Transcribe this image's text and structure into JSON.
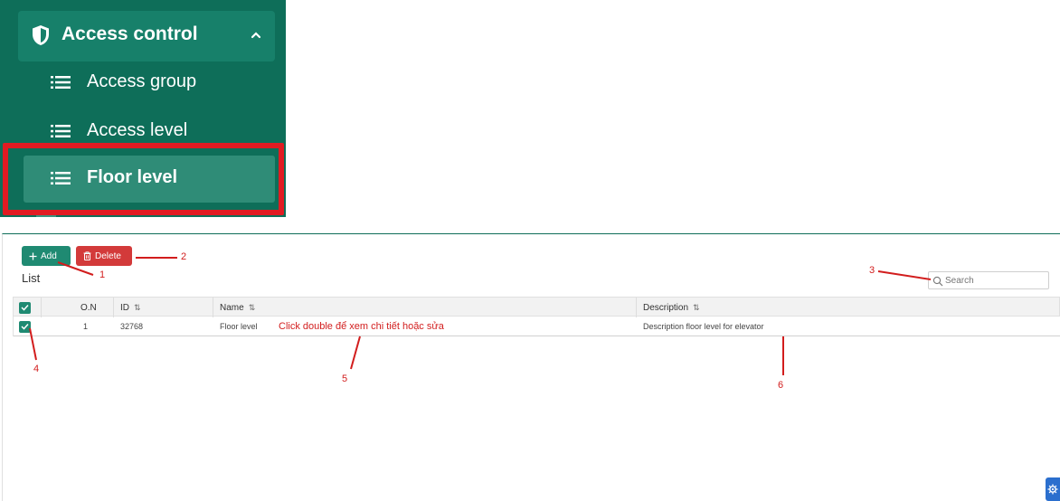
{
  "sidebar": {
    "header_label": "Access control",
    "items": [
      {
        "label": "Access group"
      },
      {
        "label": "Access level"
      },
      {
        "label": "Floor level"
      }
    ]
  },
  "toolbar": {
    "add_label": "Add",
    "delete_label": "Delete"
  },
  "list_title": "List",
  "search": {
    "placeholder": "Search"
  },
  "table": {
    "headers": {
      "on": "O.N",
      "id": "ID",
      "name": "Name",
      "description": "Description"
    },
    "rows": [
      {
        "on": "1",
        "id": "32768",
        "name": "Floor level",
        "description": "Description floor level for elevator"
      }
    ]
  },
  "annotations": {
    "n1": "1",
    "n2": "2",
    "n3": "3",
    "n4": "4",
    "n5": "5",
    "n6": "6",
    "double_click_note": "Click double để xem chi tiết hoặc sửa"
  },
  "colors": {
    "accent": "#1f8a72",
    "danger": "#d33a3a",
    "annotation": "#d21d1d",
    "sidebar_bg": "#0e6e59"
  },
  "icons": [
    "shield-icon",
    "chevron-up-icon",
    "list-icon",
    "plus-icon",
    "trash-icon",
    "search-icon",
    "check-icon",
    "sort-icon",
    "gear-icon"
  ]
}
